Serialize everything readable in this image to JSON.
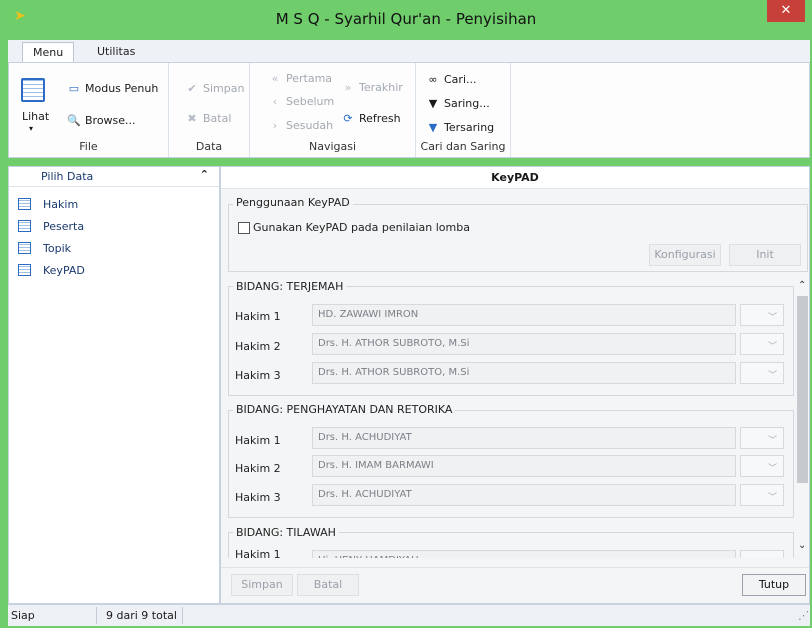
{
  "window": {
    "title": "M S Q - Syarhil Qur'an - Penyisihan",
    "close_glyph": "✕",
    "app_icon": "bird-icon"
  },
  "tabs": [
    {
      "label": "Menu"
    },
    {
      "label": "Utilitas"
    }
  ],
  "ribbon": {
    "file": {
      "lihat": "Lihat",
      "modus_penuh": "Modus Penuh",
      "browse": "Browse...",
      "label": "File"
    },
    "data": {
      "simpan": "Simpan",
      "batal": "Batal",
      "label": "Data"
    },
    "navigasi": {
      "pertama": "Pertama",
      "sebelum": "Sebelum",
      "sesudah": "Sesudah",
      "terakhir": "Terakhir",
      "refresh": "Refresh",
      "label": "Navigasi"
    },
    "cari": {
      "cari": "Cari...",
      "saring": "Saring...",
      "tersaring": "Tersaring",
      "label": "Cari dan Saring"
    }
  },
  "left_panel": {
    "header": "Pilih Data",
    "items": [
      {
        "label": "Hakim"
      },
      {
        "label": "Peserta"
      },
      {
        "label": "Topik"
      },
      {
        "label": "KeyPAD"
      }
    ]
  },
  "main": {
    "header": "KeyPAD",
    "keypad_group": {
      "legend": "Penggunaan KeyPAD",
      "checkbox_label": "Gunakan KeyPAD pada penilaian lomba",
      "checked": false,
      "konfigurasi": "Konfigurasi",
      "init": "Init"
    },
    "bidang": [
      {
        "legend": "BIDANG: TERJEMAH",
        "rows": [
          {
            "label": "Hakim 1",
            "value": "HD. ZAWAWI IMRON"
          },
          {
            "label": "Hakim 2",
            "value": "Drs. H. ATHOR SUBROTO, M.Si"
          },
          {
            "label": "Hakim 3",
            "value": "Drs. H. ATHOR SUBROTO, M.Si"
          }
        ]
      },
      {
        "legend": "BIDANG: PENGHAYATAN DAN RETORIKA",
        "rows": [
          {
            "label": "Hakim 1",
            "value": "Drs. H. ACHUDIYAT"
          },
          {
            "label": "Hakim 2",
            "value": "Drs. H. IMAM BARMAWI"
          },
          {
            "label": "Hakim 3",
            "value": "Drs. H. ACHUDIYAT"
          }
        ]
      },
      {
        "legend": "BIDANG: TILAWAH",
        "rows": [
          {
            "label": "Hakim 1",
            "value": "Hj. HENY HAMDIYAH"
          }
        ]
      }
    ],
    "footer": {
      "simpan": "Simpan",
      "batal": "Batal",
      "tutup": "Tutup"
    }
  },
  "status": {
    "text": "Siap",
    "count": "9 dari 9 total"
  }
}
